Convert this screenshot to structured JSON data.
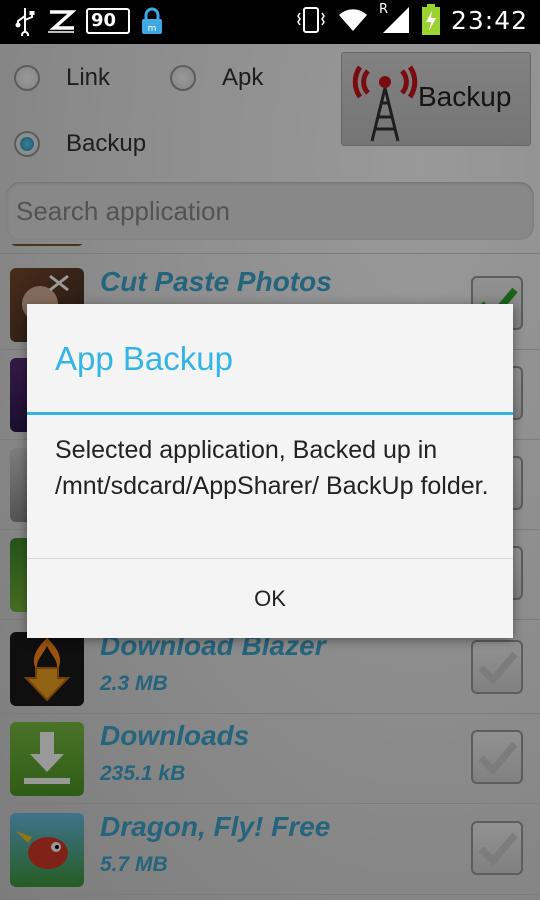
{
  "status_bar": {
    "battery_left": "90",
    "signal_letter": "R",
    "time": "23:42",
    "icons": [
      "usb-icon",
      "z-icon",
      "battery-90-icon",
      "lock-icon",
      "vibrate-icon",
      "wifi-icon",
      "signal-icon",
      "charging-battery-icon"
    ]
  },
  "options": {
    "radio_link": "Link",
    "radio_apk": "Apk",
    "radio_backup": "Backup",
    "selected": "Backup",
    "backup_button": "Backup"
  },
  "search": {
    "placeholder": "Search application"
  },
  "apps": [
    {
      "name": "Cut Paste Photos",
      "size": "",
      "checked": true,
      "icon": "cut-paste-photos-icon"
    },
    {
      "name": "",
      "size": "",
      "checked": true,
      "icon": "app-icon-purple"
    },
    {
      "name": "",
      "size": "",
      "checked": true,
      "icon": "app-icon-grey"
    },
    {
      "name": "",
      "size": "",
      "checked": true,
      "icon": "app-icon-green"
    },
    {
      "name": "Download Blazer",
      "size": "2.3 MB",
      "checked": false,
      "icon": "download-blazer-icon"
    },
    {
      "name": "Downloads",
      "size": "235.1 kB",
      "checked": false,
      "icon": "downloads-icon"
    },
    {
      "name": "Dragon, Fly! Free",
      "size": "5.7 MB",
      "checked": false,
      "icon": "dragon-fly-icon"
    }
  ],
  "dialog": {
    "title": "App Backup",
    "message": "Selected application, Backed up in /mnt/sdcard/AppSharer/ BackUp folder.",
    "ok": "OK"
  },
  "colors": {
    "accent": "#33b5e5",
    "app_name": "#3fa7d1"
  }
}
